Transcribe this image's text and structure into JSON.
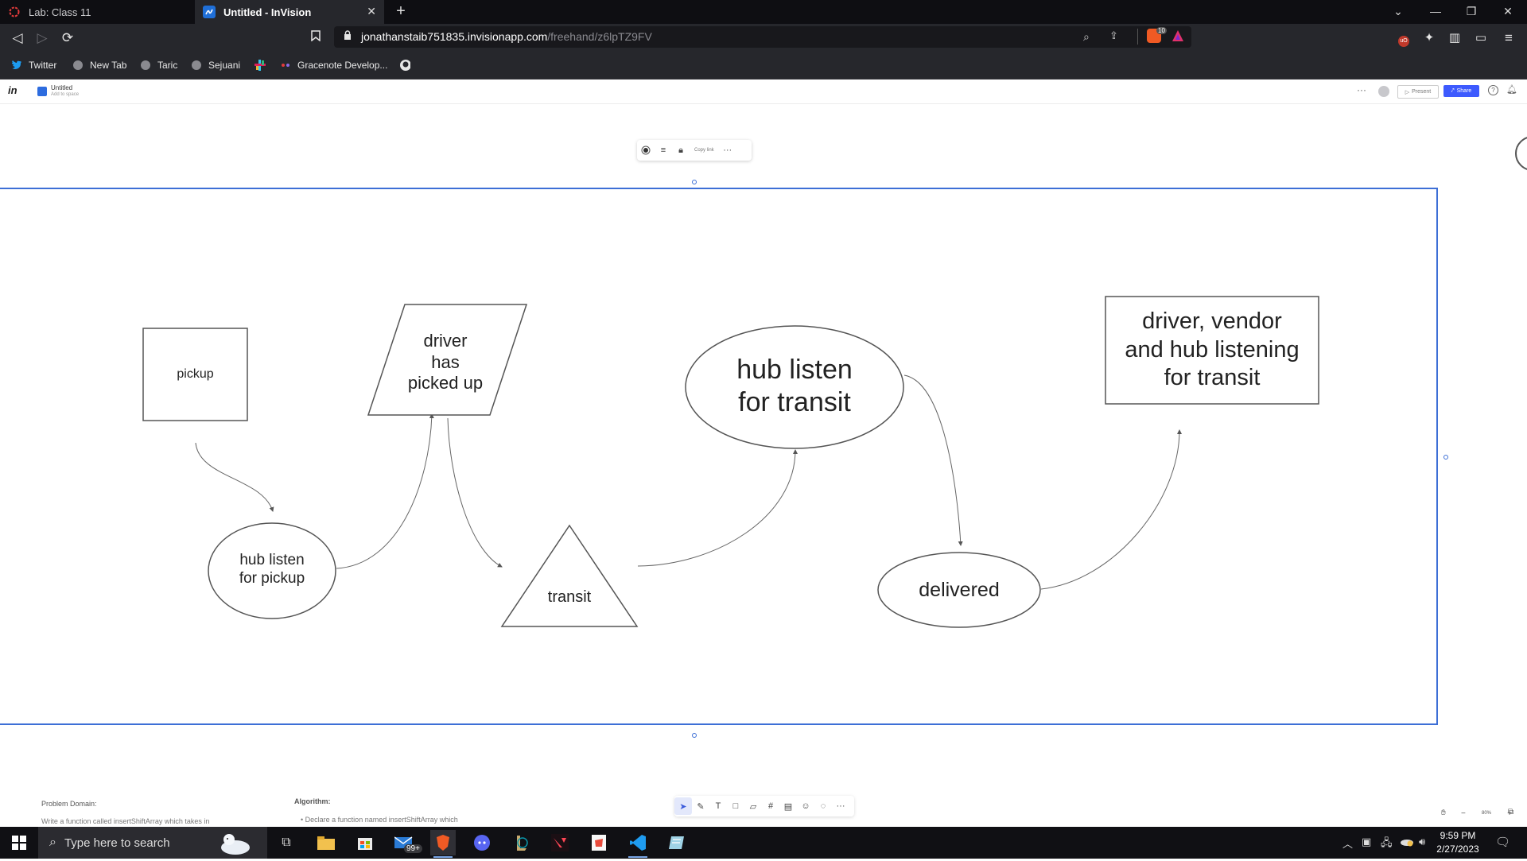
{
  "browser": {
    "tabs": [
      {
        "title": "Lab: Class 11",
        "active": false
      },
      {
        "title": "Untitled - InVision",
        "active": true
      }
    ],
    "url_host": "jonathanstaib751835.invisionapp.com",
    "url_path": "/freehand/z6lpTZ9FV",
    "bookmarks": [
      "Twitter",
      "New Tab",
      "Taric",
      "Sejuani",
      "Gracenote Develop..."
    ],
    "badge_brave": "10"
  },
  "app": {
    "logo": "in",
    "doc_title": "Untitled",
    "doc_subtitle": "Add to space",
    "present_label": "Present",
    "share_label": "Share",
    "accent": "#3d5afe"
  },
  "floating_toolbar": {
    "copy_link": "Copy link"
  },
  "diagram": {
    "nodes": {
      "pickup": "pickup",
      "driver_picked_up": [
        "driver",
        "has",
        "picked up"
      ],
      "hub_listen_transit": [
        "hub listen",
        "for transit"
      ],
      "driver_vendor_hub": [
        "driver, vendor",
        "and hub listening",
        "for transit"
      ],
      "hub_listen_pickup": [
        "hub listen",
        "for pickup"
      ],
      "transit": "transit",
      "delivered": "delivered"
    }
  },
  "notes": {
    "problem_heading": "Problem Domain:",
    "problem_text": "Write a function called insertShiftArray which takes in",
    "algorithm_heading": "Algorithm:",
    "algorithm_text": "Declare a function named insertShiftArray which"
  },
  "zoom": {
    "level": "80%"
  },
  "taskbar": {
    "search_placeholder": "Type here to search",
    "time": "9:59 PM",
    "date": "2/27/2023",
    "mail_badge": "99+"
  }
}
